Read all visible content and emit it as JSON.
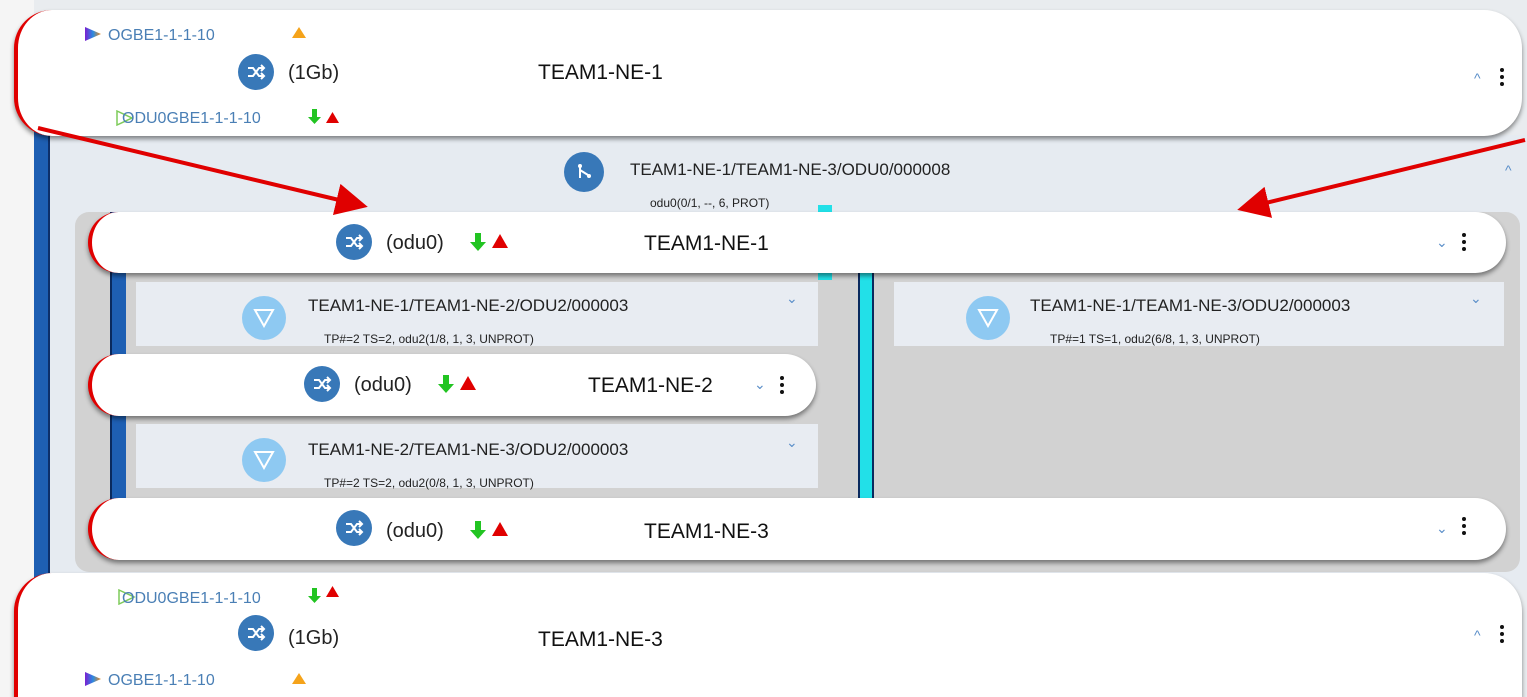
{
  "top_card": {
    "port_top": "OGBE1-1-1-10",
    "rate": "(1Gb)",
    "ne_name": "TEAM1-NE-1",
    "port_bottom": "ODU0GBE1-1-1-10"
  },
  "connection": {
    "title": "TEAM1-NE-1/TEAM1-NE-3/ODU0/000008",
    "subtitle": "odu0(0/1, --, 6, PROT)"
  },
  "ne_row_1": {
    "rate": "(odu0)",
    "ne_name": "TEAM1-NE-1"
  },
  "segment_left_1": {
    "title": "TEAM1-NE-1/TEAM1-NE-2/ODU2/000003",
    "subtitle": "TP#=2 TS=2, odu2(1/8, 1, 3, UNPROT)"
  },
  "segment_right_1": {
    "title": "TEAM1-NE-1/TEAM1-NE-3/ODU2/000003",
    "subtitle": "TP#=1 TS=1, odu2(6/8, 1, 3, UNPROT)"
  },
  "ne_row_2": {
    "rate": "(odu0)",
    "ne_name": "TEAM1-NE-2"
  },
  "segment_left_2": {
    "title": "TEAM1-NE-2/TEAM1-NE-3/ODU2/000003",
    "subtitle": "TP#=2 TS=2, odu2(0/8, 1, 3, UNPROT)"
  },
  "ne_row_3": {
    "rate": "(odu0)",
    "ne_name": "TEAM1-NE-3"
  },
  "bottom_card": {
    "port_top": "ODU0GBE1-1-1-10",
    "rate": "(1Gb)",
    "ne_name": "TEAM1-NE-3",
    "port_bottom": "OGBE1-1-1-10"
  },
  "colors": {
    "accent_red": "#e00000",
    "node_blue": "#3878b8",
    "segment_blue": "#8ec9f2",
    "protect_cyan": "#22e0e8",
    "work_blue": "#1e5fb3",
    "alarm_green": "#22c422",
    "alarm_orange": "#f5a31a"
  },
  "icons": [
    "cross-connect-icon",
    "split-route-icon",
    "segment-triangle-icon",
    "chevron-up-icon",
    "chevron-down-icon",
    "kebab-menu-icon",
    "play-triangle-icon",
    "arrow-down-icon",
    "alarm-up-icon"
  ]
}
